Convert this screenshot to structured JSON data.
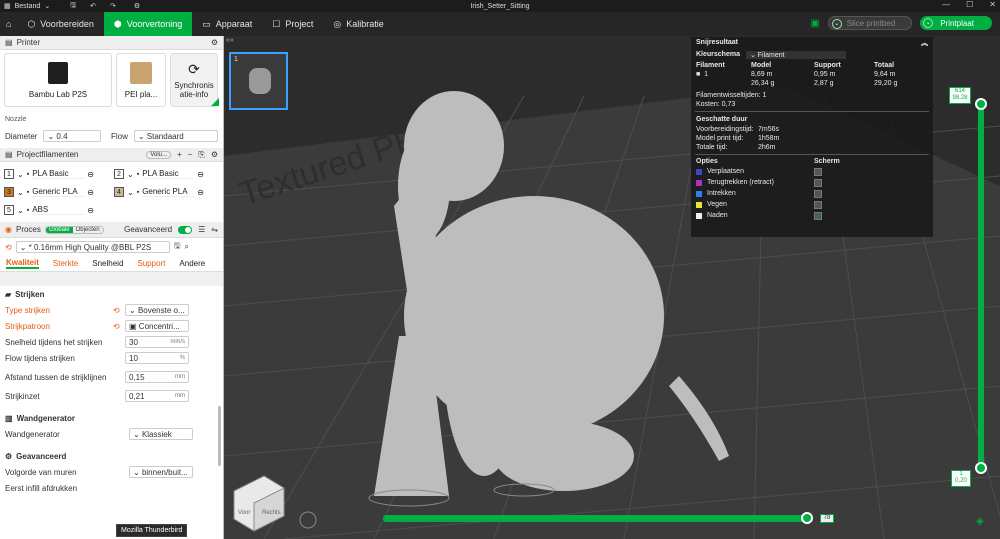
{
  "titlebar": {
    "menu": "Bestand",
    "document": "Irish_Setter_Sitting"
  },
  "tabs": [
    {
      "label": "Voorbereiden"
    },
    {
      "label": "Voorvertoning"
    },
    {
      "label": "Apparaat"
    },
    {
      "label": "Project"
    },
    {
      "label": "Kalibratie"
    }
  ],
  "actions": {
    "slice": "Slice printbed",
    "plate": "Printplaat"
  },
  "printer": {
    "section": "Printer",
    "name": "Bambu Lab P2S",
    "plate": "PEI pla...",
    "sync": "Synchronis atie-info",
    "nozzle_label": "Nozzle",
    "diameter_label": "Diameter",
    "diameter_value": "0.4",
    "flow_label": "Flow",
    "flow_value": "Standaard"
  },
  "filaments": {
    "section": "Projectfilamenten",
    "chip": "Volu...",
    "items": [
      {
        "num": "1",
        "name": "PLA Basic",
        "color": "#ffffff"
      },
      {
        "num": "2",
        "name": "PLA Basic",
        "color": "#ffffff"
      },
      {
        "num": "3",
        "name": "Generic PLA",
        "color": "#c47b22"
      },
      {
        "num": "4",
        "name": "Generic PLA",
        "color": "#c9b89a"
      },
      {
        "num": "5",
        "name": "ABS",
        "color": "#ffffff"
      }
    ]
  },
  "process": {
    "section": "Proces",
    "toggle_global": "Globale",
    "toggle_objects": "Objecten",
    "advanced": "Geavanceerd",
    "preset": "* 0.16mm High Quality @BBL P2S",
    "tabs": [
      "Kwaliteit",
      "Sterkte",
      "Snelheid",
      "Support",
      "Andere"
    ],
    "groups": {
      "ironing": "Strijken",
      "wall_gen": "Wandgenerator",
      "advanced": "Geavanceerd"
    },
    "rows": {
      "iron_type_label": "Type strijken",
      "iron_type_value": "Bovenste o...",
      "iron_pattern_label": "Strijkpatroon",
      "iron_pattern_value": "Concentri...",
      "iron_speed_label": "Snelheid tijdens het strijken",
      "iron_speed_value": "30",
      "iron_speed_unit": "mm/s",
      "iron_flow_label": "Flow tijdens strijken",
      "iron_flow_value": "10",
      "iron_flow_unit": "%",
      "iron_spacing_label": "Afstand tussen de strijklijnen",
      "iron_spacing_value": "0,15",
      "iron_spacing_unit": "mm",
      "iron_inset_label": "Strijkinzet",
      "iron_inset_value": "0,21",
      "iron_inset_unit": "mm",
      "wall_gen_label": "Wandgenerator",
      "wall_gen_value": "Klassiek",
      "wall_order_label": "Volgorde van muren",
      "wall_order_value": "binnen/buit...",
      "first_infill_label": "Eerst infill afdrukken"
    }
  },
  "tooltip": "Mozilla Thunderbird",
  "stats": {
    "title": "Snijresultaat",
    "scheme_label": "Kleurschema",
    "scheme_value": "Filament",
    "headers": [
      "Filament",
      "Model",
      "Support",
      "Totaal"
    ],
    "row_id": "1",
    "model_m": "8,69 m",
    "model_g": "26,34 g",
    "support_m": "0,95 m",
    "support_g": "2,87 g",
    "total_m": "9,64 m",
    "total_g": "29,20 g",
    "swaps": "Filamentwisseltijden:  1",
    "cost": "Kosten:  0,73",
    "est_title": "Geschatte duur",
    "prep_label": "Voorbereidingstijd:",
    "prep_value": "7m56s",
    "model_time_label": "Model print tijd:",
    "model_time_value": "1h58m",
    "total_time_label": "Totale tijd:",
    "total_time_value": "2h6m",
    "options_title": "Opties",
    "screen_title": "Scherm",
    "options": [
      {
        "label": "Verplaatsen",
        "color": "#3c44c8"
      },
      {
        "label": "Terugtrekken (retract)",
        "color": "#a533c4"
      },
      {
        "label": "Intrekken",
        "color": "#2f7fe8"
      },
      {
        "label": "Vegen",
        "color": "#e8e23a"
      },
      {
        "label": "Naden",
        "color": "#eeeeee"
      }
    ]
  },
  "layers": {
    "top_value": "614",
    "top_height": "98,28",
    "bottom_value": "1",
    "bottom_height": "0,20",
    "move_value": "78",
    "move_fraction": 0.99
  },
  "plate_text": "Textured PEI pla",
  "thumb_index": "1",
  "cube": {
    "front": "Voor",
    "right": "Rechts"
  }
}
